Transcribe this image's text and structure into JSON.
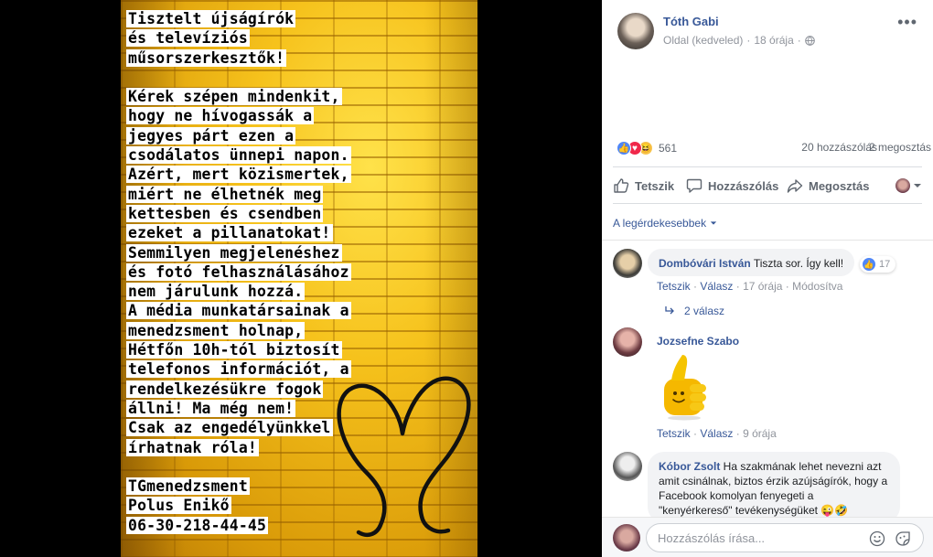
{
  "photo": {
    "notice_lines": [
      "Tisztelt újságírók",
      "és televíziós",
      "műsorszerkesztők!",
      "",
      "Kérek szépen mindenkit,",
      "hogy ne hívogassák a",
      "jegyes párt ezen a",
      "csodálatos ünnepi napon.",
      "Azért, mert közismertek,",
      "miért ne élhetnék meg",
      "kettesben és csendben",
      "ezeket a pillanatokat!",
      "Semmilyen megjelenéshez",
      "és fotó felhasználásához",
      "nem járulunk hozzá.",
      "A média munkatársainak a",
      "menedzsment holnap,",
      "Hétfőn 10h-tól biztosít",
      "telefonos információt, a",
      "rendelkezésükre fogok",
      "állni! Ma még nem!",
      "Csak az engedélyünkkel",
      "írhatnak róla!",
      "",
      "TGmenedzsment",
      "Polus Enikő",
      "06-30-218-44-45"
    ],
    "colors": {
      "wall": "#e7ad10",
      "heart_stroke": "#000000"
    }
  },
  "post": {
    "author": "Tóth Gabi",
    "meta_label": "Oldal (kedveled)",
    "time": "18 órája",
    "separator": "·",
    "reaction_count": "561",
    "comment_count": "20 hozzászólás",
    "share_count": "2 megosztás",
    "actions": {
      "like": "Tetszik",
      "comment": "Hozzászólás",
      "share": "Megosztás"
    },
    "sort_label": "A legérdekesebbek"
  },
  "comments": [
    {
      "author": "Dombóvári István",
      "text": "Tiszta sor. Így kell!",
      "like_count": "17",
      "actions": {
        "like": "Tetszik",
        "reply": "Válasz",
        "time": "17 órája",
        "edited": "Módosítva"
      },
      "replies_label": "2 válasz"
    },
    {
      "author": "Jozsefne Szabo",
      "sticker": "thumbs-up-sticker",
      "actions": {
        "like": "Tetszik",
        "reply": "Válasz",
        "time": "9 órája"
      }
    },
    {
      "author": "Kóbor Zsolt",
      "text": "Ha szakmának lehet nevezni azt amit csinálnak, biztos érzik azújságírók, hogy a Facebook komolyan fenyegeti a \"kenyérkereső\" tevékenységüket 😜🤣"
    }
  ],
  "composer": {
    "placeholder": "Hozzászólás írása..."
  },
  "theme": {
    "link": "#385898",
    "muted": "#90949c",
    "like_blue": "#4f86f7",
    "love_red": "#f0284a"
  }
}
